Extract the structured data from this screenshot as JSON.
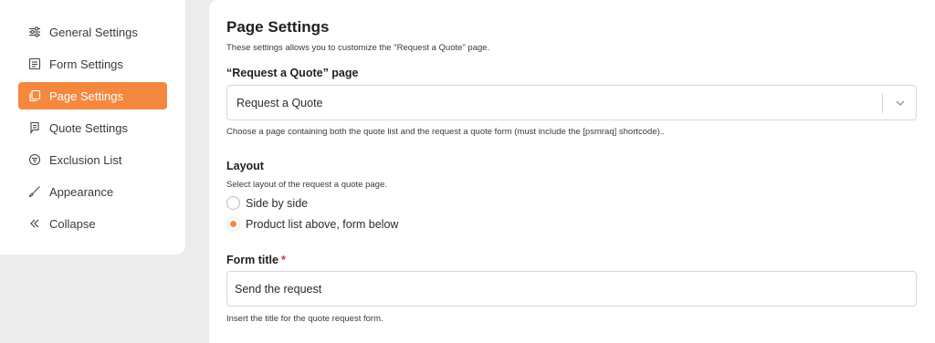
{
  "sidebar": {
    "items": [
      {
        "label": "General Settings",
        "icon": "sliders-icon"
      },
      {
        "label": "Form Settings",
        "icon": "form-icon"
      },
      {
        "label": "Page Settings",
        "icon": "pages-icon",
        "active": true
      },
      {
        "label": "Quote Settings",
        "icon": "quote-icon"
      },
      {
        "label": "Exclusion List",
        "icon": "filter-icon"
      },
      {
        "label": "Appearance",
        "icon": "brush-icon"
      },
      {
        "label": "Collapse",
        "icon": "double-chevron-left-icon"
      }
    ]
  },
  "main": {
    "title": "Page Settings",
    "description": "These settings allows you to customize the \"Request a Quote\" page.",
    "quote_page": {
      "label": "“Request a Quote” page",
      "selected": "Request a Quote",
      "help": "Choose a page containing both the quote list and the request a quote form (must include the [psmraq] shortcode).."
    },
    "layout": {
      "label": "Layout",
      "help": "Select layout of the request a quote page.",
      "options": [
        {
          "label": "Side by side",
          "checked": false
        },
        {
          "label": "Product list above, form below",
          "checked": true
        }
      ]
    },
    "form_title": {
      "label": "Form title",
      "required_mark": "*",
      "value": "Send the request",
      "help": "Insert the title for the quote request form."
    }
  },
  "colors": {
    "accent": "#f5883f",
    "required": "#d63638"
  }
}
